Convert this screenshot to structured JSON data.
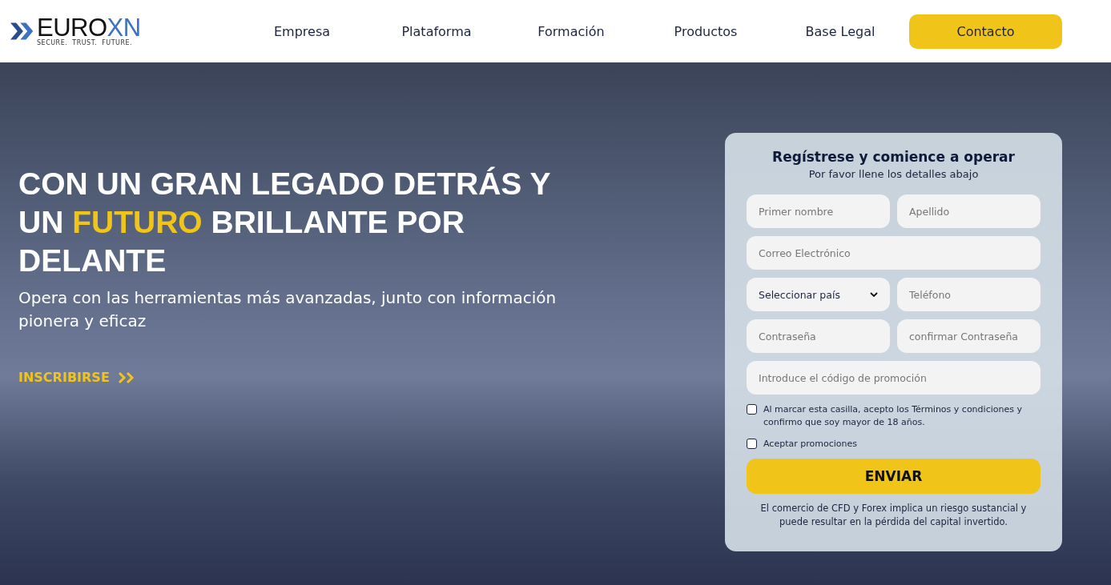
{
  "logo": {
    "word": "EURO",
    "accent": "XN",
    "tagline": "SECURE.  TRUST.  FUTURE."
  },
  "nav": {
    "items": [
      {
        "label": "Empresa"
      },
      {
        "label": "Plataforma"
      },
      {
        "label": "Formación"
      },
      {
        "label": "Productos"
      },
      {
        "label": "Base Legal"
      }
    ],
    "cta": "Contacto"
  },
  "hero": {
    "headline": [
      {
        "text": "CON UN GRAN LEGADO DETRÁS Y UN ",
        "highlight": false
      },
      {
        "text": "FUTURO",
        "highlight": true
      },
      {
        "text": " BRILLANTE POR DELANTE",
        "highlight": false
      }
    ],
    "subtitle": "Opera con las herramientas más avanzadas, junto con información pionera y eficaz",
    "link": "INSCRIBIRSE"
  },
  "form": {
    "title": "Regístrese y comience a operar",
    "subtitle": "Por favor llene los detalles abajo",
    "fields": [
      {
        "kind": "input",
        "placeholder": "Primer nombre",
        "wide": false
      },
      {
        "kind": "input",
        "placeholder": "Apellido",
        "wide": false
      },
      {
        "kind": "input",
        "placeholder": "Correo Electrónico",
        "wide": true
      },
      {
        "kind": "select",
        "value": "Seleccionar país",
        "wide": false
      },
      {
        "kind": "input",
        "placeholder": "Teléfono",
        "wide": false
      },
      {
        "kind": "input",
        "placeholder": "Contraseña",
        "wide": false
      },
      {
        "kind": "input",
        "placeholder": "confirmar Contraseña",
        "wide": false
      },
      {
        "kind": "input",
        "placeholder": "Introduce el código de promoción",
        "wide": true
      }
    ],
    "checkboxes": [
      {
        "label": "Al marcar esta casilla, acepto los Términos y condiciones y confirmo que soy mayor de 18 años.",
        "checked": false
      },
      {
        "label": "Aceptar promociones",
        "checked": false
      }
    ],
    "submit": "ENVIAR",
    "disclaimer": "El comercio de CFD y Forex implica un riesgo sustancial y puede resultar en la pérdida del capital invertido."
  }
}
